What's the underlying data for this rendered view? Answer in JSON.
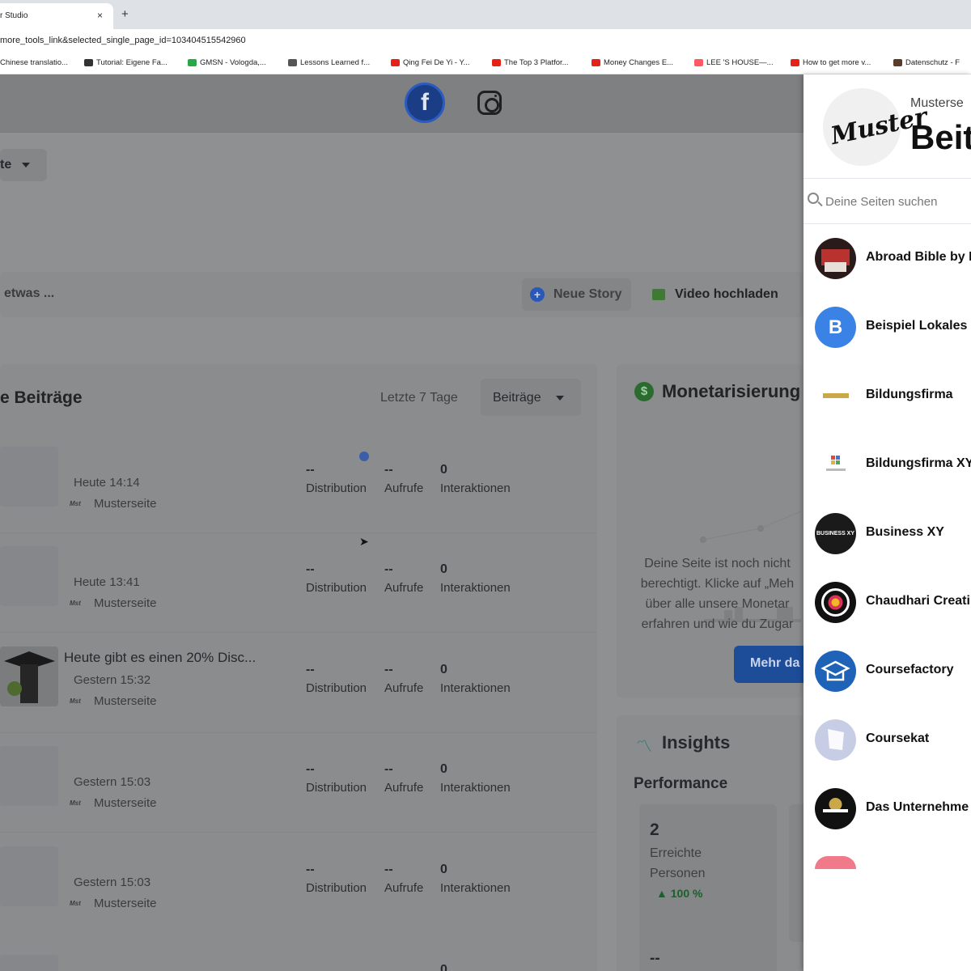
{
  "browser": {
    "tab_title": "r Studio",
    "tab_close": "×",
    "new_tab": "+",
    "url": "more_tools_link&selected_single_page_id=103404515542960",
    "bookmarks": [
      {
        "label": "Chinese translatio...",
        "color": "#5b8fd6"
      },
      {
        "label": "Tutorial: Eigene Fa...",
        "color": "#333333",
        "glyph": "#"
      },
      {
        "label": "GMSN - Vologda,...",
        "color": "#27a844"
      },
      {
        "label": "Lessons Learned f...",
        "color": "#555555"
      },
      {
        "label": "Qing Fei De Yi - Y...",
        "color": "#e62117"
      },
      {
        "label": "The Top 3 Platfor...",
        "color": "#e62117"
      },
      {
        "label": "Money Changes E...",
        "color": "#e62117"
      },
      {
        "label": "LEE 'S HOUSE—...",
        "color": "#ff5a5f"
      },
      {
        "label": "How to get more v...",
        "color": "#e62117"
      },
      {
        "label": "Datenschutz - F",
        "color": "#5a3a2a"
      }
    ]
  },
  "topnav": {
    "facebook_glyph": "f"
  },
  "page": {
    "dropdown_label": "te",
    "composer_text": "etwas ...",
    "new_story": "Neue Story",
    "upload_video": "Video hochladen"
  },
  "posts": {
    "title": "e Beiträge",
    "range": "Letzte 7 Tage",
    "filter": "Beiträge",
    "metric_labels": {
      "distribution": "Distribution",
      "views": "Aufrufe",
      "interactions": "Interaktionen"
    },
    "rows": [
      {
        "title": "",
        "time": "Heute 14:14",
        "page": "Musterseite",
        "distribution": "--",
        "views": "--",
        "interactions": "0"
      },
      {
        "title": "",
        "time": "Heute 13:41",
        "page": "Musterseite",
        "distribution": "--",
        "views": "--",
        "interactions": "0"
      },
      {
        "title": "Heute gibt es einen 20% Disc...",
        "time": "Gestern 15:32",
        "page": "Musterseite",
        "distribution": "--",
        "views": "--",
        "interactions": "0"
      },
      {
        "title": "",
        "time": "Gestern 15:03",
        "page": "Musterseite",
        "distribution": "--",
        "views": "--",
        "interactions": "0"
      },
      {
        "title": "",
        "time": "Gestern 15:03",
        "page": "Musterseite",
        "distribution": "--",
        "views": "--",
        "interactions": "0"
      }
    ],
    "partial_row_value": "0"
  },
  "monetization": {
    "title": "Monetarisierung",
    "text_lines": [
      "Deine Seite ist noch nicht",
      "berechtigt. Klicke auf „Meh",
      "über alle unsere Monetar",
      "erfahren und wie du Zugar"
    ],
    "button": "Mehr da"
  },
  "insights": {
    "title": "Insights",
    "performance": "Performance",
    "card": {
      "value": "2",
      "label": "Erreichte Personen",
      "change": "▲ 100 %"
    },
    "card2_value": "--"
  },
  "switcher": {
    "page_name": "Musterse",
    "heading": "Beit",
    "logo_text": "Muster",
    "search_placeholder": "Deine Seiten suchen",
    "pages": [
      {
        "label": "Abroad Bible by I",
        "avatar_color": "#2a1a1a",
        "avatar_text": ""
      },
      {
        "label": "Beispiel Lokales",
        "avatar_color": "#3b82e6",
        "avatar_text": "B"
      },
      {
        "label": "Bildungsfirma",
        "avatar_color": "#ffffff",
        "avatar_text": ""
      },
      {
        "label": "Bildungsfirma XY",
        "avatar_color": "#ffffff",
        "avatar_text": ""
      },
      {
        "label": "Business XY",
        "avatar_color": "#1a1a1a",
        "avatar_text": "BUSINESS XY"
      },
      {
        "label": "Chaudhari Creati",
        "avatar_color": "#111111",
        "avatar_text": ""
      },
      {
        "label": "Coursefactory",
        "avatar_color": "#1e63b8",
        "avatar_text": ""
      },
      {
        "label": "Coursekat",
        "avatar_color": "#c8cde6",
        "avatar_text": ""
      },
      {
        "label": "Das Unternehme",
        "avatar_color": "#111111",
        "avatar_text": ""
      }
    ]
  }
}
